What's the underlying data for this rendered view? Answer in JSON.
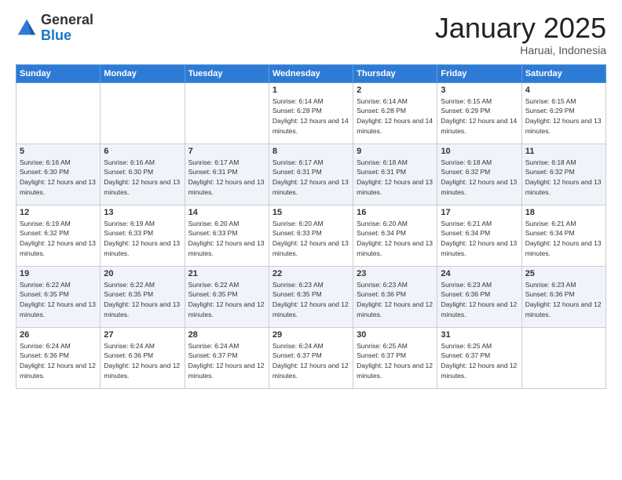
{
  "logo": {
    "general": "General",
    "blue": "Blue"
  },
  "header": {
    "month": "January 2025",
    "location": "Haruai, Indonesia"
  },
  "weekdays": [
    "Sunday",
    "Monday",
    "Tuesday",
    "Wednesday",
    "Thursday",
    "Friday",
    "Saturday"
  ],
  "weeks": [
    [
      {
        "day": "",
        "sunrise": "",
        "sunset": "",
        "daylight": ""
      },
      {
        "day": "",
        "sunrise": "",
        "sunset": "",
        "daylight": ""
      },
      {
        "day": "",
        "sunrise": "",
        "sunset": "",
        "daylight": ""
      },
      {
        "day": "1",
        "sunrise": "Sunrise: 6:14 AM",
        "sunset": "Sunset: 6:28 PM",
        "daylight": "Daylight: 12 hours and 14 minutes."
      },
      {
        "day": "2",
        "sunrise": "Sunrise: 6:14 AM",
        "sunset": "Sunset: 6:28 PM",
        "daylight": "Daylight: 12 hours and 14 minutes."
      },
      {
        "day": "3",
        "sunrise": "Sunrise: 6:15 AM",
        "sunset": "Sunset: 6:29 PM",
        "daylight": "Daylight: 12 hours and 14 minutes."
      },
      {
        "day": "4",
        "sunrise": "Sunrise: 6:15 AM",
        "sunset": "Sunset: 6:29 PM",
        "daylight": "Daylight: 12 hours and 13 minutes."
      }
    ],
    [
      {
        "day": "5",
        "sunrise": "Sunrise: 6:16 AM",
        "sunset": "Sunset: 6:30 PM",
        "daylight": "Daylight: 12 hours and 13 minutes."
      },
      {
        "day": "6",
        "sunrise": "Sunrise: 6:16 AM",
        "sunset": "Sunset: 6:30 PM",
        "daylight": "Daylight: 12 hours and 13 minutes."
      },
      {
        "day": "7",
        "sunrise": "Sunrise: 6:17 AM",
        "sunset": "Sunset: 6:31 PM",
        "daylight": "Daylight: 12 hours and 13 minutes."
      },
      {
        "day": "8",
        "sunrise": "Sunrise: 6:17 AM",
        "sunset": "Sunset: 6:31 PM",
        "daylight": "Daylight: 12 hours and 13 minutes."
      },
      {
        "day": "9",
        "sunrise": "Sunrise: 6:18 AM",
        "sunset": "Sunset: 6:31 PM",
        "daylight": "Daylight: 12 hours and 13 minutes."
      },
      {
        "day": "10",
        "sunrise": "Sunrise: 6:18 AM",
        "sunset": "Sunset: 6:32 PM",
        "daylight": "Daylight: 12 hours and 13 minutes."
      },
      {
        "day": "11",
        "sunrise": "Sunrise: 6:18 AM",
        "sunset": "Sunset: 6:32 PM",
        "daylight": "Daylight: 12 hours and 13 minutes."
      }
    ],
    [
      {
        "day": "12",
        "sunrise": "Sunrise: 6:19 AM",
        "sunset": "Sunset: 6:32 PM",
        "daylight": "Daylight: 12 hours and 13 minutes."
      },
      {
        "day": "13",
        "sunrise": "Sunrise: 6:19 AM",
        "sunset": "Sunset: 6:33 PM",
        "daylight": "Daylight: 12 hours and 13 minutes."
      },
      {
        "day": "14",
        "sunrise": "Sunrise: 6:20 AM",
        "sunset": "Sunset: 6:33 PM",
        "daylight": "Daylight: 12 hours and 13 minutes."
      },
      {
        "day": "15",
        "sunrise": "Sunrise: 6:20 AM",
        "sunset": "Sunset: 6:33 PM",
        "daylight": "Daylight: 12 hours and 13 minutes."
      },
      {
        "day": "16",
        "sunrise": "Sunrise: 6:20 AM",
        "sunset": "Sunset: 6:34 PM",
        "daylight": "Daylight: 12 hours and 13 minutes."
      },
      {
        "day": "17",
        "sunrise": "Sunrise: 6:21 AM",
        "sunset": "Sunset: 6:34 PM",
        "daylight": "Daylight: 12 hours and 13 minutes."
      },
      {
        "day": "18",
        "sunrise": "Sunrise: 6:21 AM",
        "sunset": "Sunset: 6:34 PM",
        "daylight": "Daylight: 12 hours and 13 minutes."
      }
    ],
    [
      {
        "day": "19",
        "sunrise": "Sunrise: 6:22 AM",
        "sunset": "Sunset: 6:35 PM",
        "daylight": "Daylight: 12 hours and 13 minutes."
      },
      {
        "day": "20",
        "sunrise": "Sunrise: 6:22 AM",
        "sunset": "Sunset: 6:35 PM",
        "daylight": "Daylight: 12 hours and 13 minutes."
      },
      {
        "day": "21",
        "sunrise": "Sunrise: 6:22 AM",
        "sunset": "Sunset: 6:35 PM",
        "daylight": "Daylight: 12 hours and 12 minutes."
      },
      {
        "day": "22",
        "sunrise": "Sunrise: 6:23 AM",
        "sunset": "Sunset: 6:35 PM",
        "daylight": "Daylight: 12 hours and 12 minutes."
      },
      {
        "day": "23",
        "sunrise": "Sunrise: 6:23 AM",
        "sunset": "Sunset: 6:36 PM",
        "daylight": "Daylight: 12 hours and 12 minutes."
      },
      {
        "day": "24",
        "sunrise": "Sunrise: 6:23 AM",
        "sunset": "Sunset: 6:36 PM",
        "daylight": "Daylight: 12 hours and 12 minutes."
      },
      {
        "day": "25",
        "sunrise": "Sunrise: 6:23 AM",
        "sunset": "Sunset: 6:36 PM",
        "daylight": "Daylight: 12 hours and 12 minutes."
      }
    ],
    [
      {
        "day": "26",
        "sunrise": "Sunrise: 6:24 AM",
        "sunset": "Sunset: 6:36 PM",
        "daylight": "Daylight: 12 hours and 12 minutes."
      },
      {
        "day": "27",
        "sunrise": "Sunrise: 6:24 AM",
        "sunset": "Sunset: 6:36 PM",
        "daylight": "Daylight: 12 hours and 12 minutes."
      },
      {
        "day": "28",
        "sunrise": "Sunrise: 6:24 AM",
        "sunset": "Sunset: 6:37 PM",
        "daylight": "Daylight: 12 hours and 12 minutes."
      },
      {
        "day": "29",
        "sunrise": "Sunrise: 6:24 AM",
        "sunset": "Sunset: 6:37 PM",
        "daylight": "Daylight: 12 hours and 12 minutes."
      },
      {
        "day": "30",
        "sunrise": "Sunrise: 6:25 AM",
        "sunset": "Sunset: 6:37 PM",
        "daylight": "Daylight: 12 hours and 12 minutes."
      },
      {
        "day": "31",
        "sunrise": "Sunrise: 6:25 AM",
        "sunset": "Sunset: 6:37 PM",
        "daylight": "Daylight: 12 hours and 12 minutes."
      },
      {
        "day": "",
        "sunrise": "",
        "sunset": "",
        "daylight": ""
      }
    ]
  ]
}
